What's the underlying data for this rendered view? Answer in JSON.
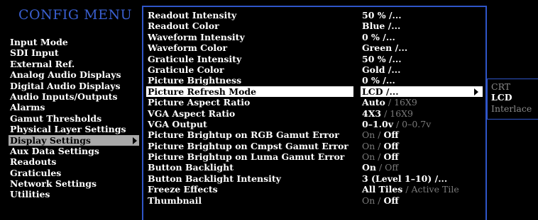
{
  "menu_title": "CONFIG MENU",
  "left_menu": [
    "Input Mode",
    "SDI Input",
    "External Ref.",
    "Analog Audio Displays",
    "Digital Audio Displays",
    "Audio Inputs/Outputs",
    "Alarms",
    "Gamut Thresholds",
    "Physical Layer Settings",
    "Display Settings",
    "Aux Data Settings",
    "Readouts",
    "Graticules",
    "Network Settings",
    "Utilities"
  ],
  "left_selected_index": 9,
  "settings": [
    {
      "name": "Readout Intensity",
      "value": "50 %   /...",
      "dim": ""
    },
    {
      "name": "Readout Color",
      "value": "Blue /...",
      "dim": ""
    },
    {
      "name": "Waveform Intensity",
      "value": "0 %   /...",
      "dim": ""
    },
    {
      "name": "Waveform Color",
      "value": "Green /...",
      "dim": ""
    },
    {
      "name": "Graticule Intensity",
      "value": "50 %   /...",
      "dim": ""
    },
    {
      "name": "Graticule Color",
      "value": "Gold /...",
      "dim": ""
    },
    {
      "name": "Picture Brightness",
      "value": "0 %   /...",
      "dim": ""
    },
    {
      "name": "Picture Refresh Mode",
      "value": "LCD /...",
      "dim": ""
    },
    {
      "name": "Picture Aspect Ratio",
      "value": "Auto",
      "dim": " / 16X9"
    },
    {
      "name": "VGA Aspect Ratio",
      "value": "4X3",
      "dim": " / 16X9"
    },
    {
      "name": "VGA Output",
      "value": "0–1.0v",
      "dim": " / 0–0.7v"
    },
    {
      "name": "Picture Brightup on RGB Gamut Error",
      "pre": "On / ",
      "value": "Off",
      "dim": ""
    },
    {
      "name": "Picture Brightup on Cmpst Gamut Error",
      "pre": "On / ",
      "value": "Off",
      "dim": ""
    },
    {
      "name": "Picture Brightup on Luma Gamut Error",
      "pre": "On / ",
      "value": "Off",
      "dim": ""
    },
    {
      "name": "Button Backlight",
      "value": "On",
      "dim": " / Off"
    },
    {
      "name": "Button Backlight Intensity",
      "value": " 3 (Level 1–10) /...",
      "dim": ""
    },
    {
      "name": "Freeze Effects",
      "value": "All Tiles",
      "dim": " / Active Tile"
    },
    {
      "name": "Thumbnail",
      "pre": "On / ",
      "value": "Off",
      "dim": ""
    }
  ],
  "selected_setting_index": 7,
  "submenu": [
    "CRT",
    "LCD",
    "Interlace"
  ],
  "submenu_active_index": 1,
  "colors": {
    "accent_blue": "#2f55c8",
    "title_blue": "#3a5fd0",
    "highlight": "#a8a8a8"
  }
}
